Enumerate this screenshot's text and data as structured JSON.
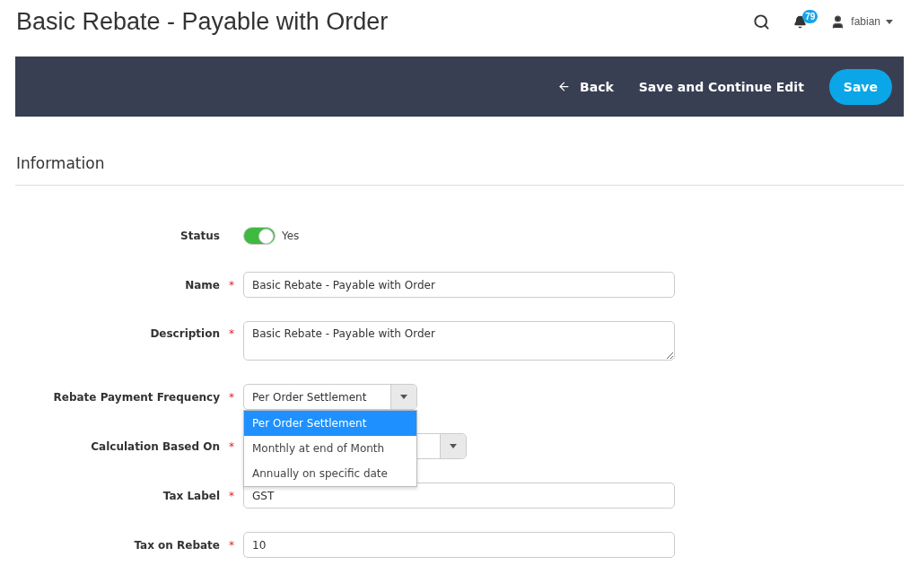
{
  "page_title": "Basic Rebate - Payable with Order",
  "header": {
    "notifications": "79",
    "user": "fabian"
  },
  "action_bar": {
    "back": "Back",
    "save_continue": "Save and Continue Edit",
    "save": "Save"
  },
  "section": {
    "title": "Information"
  },
  "fields": [
    {
      "kind": "toggle",
      "label": "Status",
      "on": true,
      "value": "Yes"
    },
    {
      "kind": "text",
      "label": "Name",
      "required_mark": "*",
      "value": "Basic Rebate - Payable with Order"
    },
    {
      "kind": "textarea",
      "label": "Description",
      "required_mark": "*",
      "value": "Basic Rebate - Payable with Order"
    },
    {
      "kind": "select",
      "label": "Rebate Payment Frequency",
      "required_mark": "*",
      "value": "Per Order Settlement",
      "expanded": true,
      "options": [
        {
          "label": "Per Order Settlement",
          "selected": true
        },
        {
          "label": "Monthly at end of Month",
          "selected": false
        },
        {
          "label": "Annually on specific date",
          "selected": false
        }
      ]
    },
    {
      "kind": "select",
      "label": "Calculation Based On",
      "required_mark": "*",
      "expanded": false,
      "wide": true
    },
    {
      "kind": "text",
      "label": "Tax Label",
      "required_mark": "*",
      "value": "GST"
    },
    {
      "kind": "text",
      "label": "Tax on Rebate",
      "required_mark": "*",
      "value": "10"
    }
  ]
}
